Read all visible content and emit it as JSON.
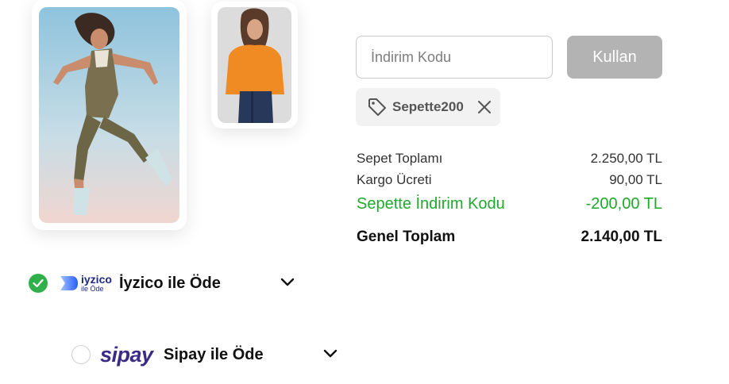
{
  "products": [
    {
      "image": "jumping-woman-photo"
    },
    {
      "image": "woman-orange-sweater-photo"
    }
  ],
  "coupon": {
    "placeholder": "İndirim Kodu",
    "apply_label": "Kullan",
    "applied_code": "Sepette200"
  },
  "summary": {
    "rows": [
      {
        "label": "Sepet Toplamı",
        "value": "2.250,00 TL"
      },
      {
        "label": "Kargo Ücreti",
        "value": "90,00 TL"
      },
      {
        "label": "Sepette İndirim Kodu",
        "value": "-200,00 TL"
      }
    ],
    "total": {
      "label": "Genel Toplam",
      "value": "2.140,00 TL"
    }
  },
  "payment": {
    "options": [
      {
        "logo_text": "iyzico",
        "logo_subtext": "ile Öde",
        "label": "İyzico ile Öde",
        "selected": true
      },
      {
        "logo_text": "sipay",
        "label": "Sipay ile Öde",
        "selected": false
      }
    ]
  },
  "colors": {
    "discount": "#1faa2e",
    "selected_radio": "#2fb04a",
    "button_disabled": "#b3b3b3",
    "iyzico": "#1d2a8a",
    "sipay": "#3b2a86"
  }
}
